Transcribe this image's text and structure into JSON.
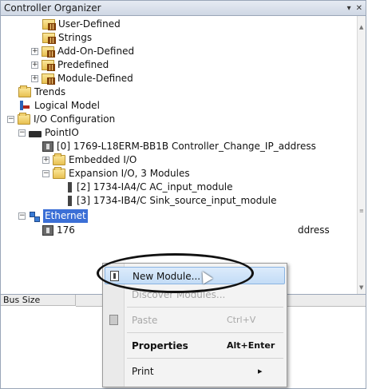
{
  "panel": {
    "title": "Controller Organizer",
    "pin_glyph": "▾",
    "pin_icon": "pin-icon",
    "close_glyph": "✕"
  },
  "tree": {
    "user_defined": "User-Defined",
    "strings": "Strings",
    "add_on_defined": "Add-On-Defined",
    "predefined": "Predefined",
    "module_defined": "Module-Defined",
    "trends": "Trends",
    "logical_model": "Logical Model",
    "io_configuration": "I/O Configuration",
    "pointio": "PointIO",
    "controller": "[0] 1769-L18ERM-BB1B Controller_Change_IP_address",
    "embedded_io": "Embedded I/O",
    "expansion_io": "Expansion I/O, 3 Modules",
    "module_2": "[2] 1734-IA4/C AC_input_module",
    "module_3": "[3] 1734-IB4/C Sink_source_input_module",
    "ethernet": "Ethernet",
    "ethernet_child_prefix": "176",
    "ethernet_child_suffix": "ddress"
  },
  "bottom_pane": {
    "column_header": "Bus Size"
  },
  "context_menu": {
    "new_module": "New Module...",
    "discover_modules": "Discover Modules...",
    "paste": "Paste",
    "paste_shortcut": "Ctrl+V",
    "properties": "Properties",
    "properties_shortcut": "Alt+Enter",
    "print": "Print",
    "print_arrow": "▸"
  },
  "colors": {
    "selection": "#3b6fd6",
    "highlight": "#c3dcf6",
    "folder": "#e8c051"
  }
}
